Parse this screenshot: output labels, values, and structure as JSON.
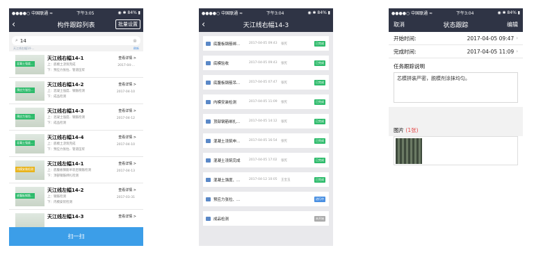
{
  "status_bar": {
    "carrier": "●●●●○ 中国联通 ≈",
    "battery": "◉ ✱ 84% ▮"
  },
  "screen1": {
    "time": "下午3:05",
    "title": "构件跟踪列表",
    "batch_button": "批量设置",
    "search_value": "14",
    "hint_left": "天江线右幅14-…",
    "hint_right": "刷新",
    "detail_label": "查看详情 >",
    "items": [
      {
        "name": "天江线右幅14-1",
        "tag": "混凝土强度...",
        "tag_color": "green",
        "l1": "上：底模土浇筑完成",
        "l2": "下：预应力张拉、管道压浆",
        "date": "2017-04-..."
      },
      {
        "name": "天江线右幅14-2",
        "tag": "预应力张拉...",
        "tag_color": "green",
        "l1": "上：混凝土强度、钢筋检测",
        "l2": "下：成品检测",
        "date": "2017-04-10"
      },
      {
        "name": "天江线右幅14-3",
        "tag": "预应力张拉...",
        "tag_color": "green",
        "l1": "上：混凝土强度、钢筋检测",
        "l2": "下：成品检测",
        "date": "2017-04-12"
      },
      {
        "name": "天江线右幅14-4",
        "tag": "混凝土强度...",
        "tag_color": "green",
        "l1": "上：底模土浇筑完成",
        "l2": "下：预应力张拉、管道压浆",
        "date": "2017-04-10"
      },
      {
        "name": "天江线左幅14-1",
        "tag": "内模安装检测",
        "tag_color": "yellow",
        "l1": "上：底腹板钢筋吊装后钢筋检测",
        "l2": "下：顶部钢筋绑扎检测",
        "date": "2017-04-13"
      },
      {
        "name": "天江线左幅14-2",
        "tag": "底腹板钢筋...",
        "tag_color": "green",
        "l1": "上：钢筋检测",
        "l2": "下：内模安装检测",
        "date": "2017-03-31"
      },
      {
        "name": "天江线左幅14-3",
        "tag": "",
        "tag_color": "green",
        "l1": "",
        "l2": "",
        "date": ""
      }
    ],
    "scan_label": "扫一扫"
  },
  "screen2": {
    "time": "下午3:04",
    "title": "天江线右幅14-3",
    "items": [
      {
        "label": "底腹板钢筋绑...",
        "date": "2017-04-05 09:43",
        "who": "张宪",
        "badge": "已完成",
        "badge_color": "green"
      },
      {
        "label": "底模验收",
        "date": "2017-04-05 09:43",
        "who": "张宪",
        "badge": "已完成",
        "badge_color": "green"
      },
      {
        "label": "底腹板钢筋吊...",
        "date": "2017-04-05 07:47",
        "who": "张宪",
        "badge": "已完成",
        "badge_color": "green"
      },
      {
        "label": "内模安装检测",
        "date": "2017-04-05 11:09",
        "who": "张宪",
        "badge": "已完成",
        "badge_color": "green"
      },
      {
        "label": "顶部钢筋绑扎...",
        "date": "2017-04-05 14:12",
        "who": "张宪",
        "badge": "已完成",
        "badge_color": "green"
      },
      {
        "label": "混凝土浇筑申...",
        "date": "2017-04-05 16:54",
        "who": "张宪",
        "badge": "已完成",
        "badge_color": "green"
      },
      {
        "label": "混凝土浇筑完成",
        "date": "2017-04-05 17:02",
        "who": "张宪",
        "badge": "已完成",
        "badge_color": "green"
      },
      {
        "label": "混凝土强度、...",
        "date": "2017-04-12 10:05",
        "who": "王宝玉",
        "badge": "已完成",
        "badge_color": "green"
      },
      {
        "label": "预应力张拉、...",
        "date": "",
        "who": "",
        "badge": "进行中",
        "badge_color": "blue"
      },
      {
        "label": "成品检测",
        "date": "",
        "who": "",
        "badge": "未开始",
        "badge_color": "gray"
      }
    ]
  },
  "screen3": {
    "time": "下午3:04",
    "title": "状态跟踪",
    "cancel": "取消",
    "edit": "编辑",
    "start_label": "开始时间:",
    "start_value": "2017-04-05 09:47",
    "end_label": "完成时间:",
    "end_value": "2017-04-05 11:09",
    "desc_label": "任务跟踪说明",
    "desc_text": "芯模拼装严密，脱模剂涂抹均匀。",
    "images_label": "图片",
    "images_count": "(1张)"
  }
}
